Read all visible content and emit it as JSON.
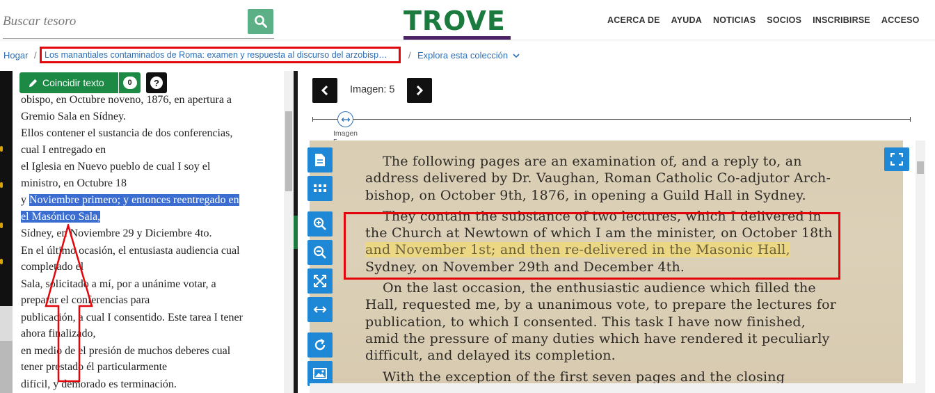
{
  "search": {
    "placeholder": "Buscar tesoro"
  },
  "logo": {
    "text": "TROVE"
  },
  "nav": [
    "ACERCA DE",
    "AYUDA",
    "NOTICIAS",
    "SOCIOS",
    "INSCRIBIRSE",
    "ACCESO"
  ],
  "breadcrumb": {
    "home": "Hogar",
    "separator": "/",
    "current": "Los manantiales contaminados de Roma: examen y respuesta al discurso del arzobisp…",
    "explore": "Explora esta colección"
  },
  "text_panel": {
    "match_button": "Coincidir texto",
    "count": "0",
    "help": "?",
    "lines": [
      [
        "obispo, en Octubre noveno, 1876, en apertura a",
        "Gremio Sala en Sídney."
      ],
      [
        "Ellos contener el sustancia de dos conferencias,",
        "cual I entregado en"
      ],
      [
        "el Iglesia en Nuevo pueblo de cual I soy el",
        "ministro, en Octubre 18"
      ],
      [
        "Sídney, en Noviembre 29 y Diciembre 4to."
      ],
      [
        "En el último ocasión, el entusiasta audiencia cual",
        "completado el"
      ],
      [
        "Sala, solicitado a mí, por a unánime votar, a",
        "preparar el conferencias para"
      ],
      [
        "publicación, a cual I consentido. Este tarea I tener",
        "ahora finalizado,"
      ],
      [
        "en medio de el presión de muchos deberes cual",
        "tener prestado él particularmente"
      ],
      [
        "difícil, y demorado es terminación."
      ]
    ],
    "highlight_prefix": "y",
    "highlight_text_1": "Noviembre primero; y entonces reentregado en",
    "highlight_text_2": "el Masónico Sala,"
  },
  "viewer": {
    "image_label": "Imagen: 5",
    "slider_label_1": "Imagen",
    "slider_label_2": "5",
    "scan_paragraphs": [
      [
        "The following pages are an examination of, and a reply to, an",
        "address delivered by Dr. Vaughan, Roman Catholic Co-adjutor Arch-",
        "bishop, on October 9th, 1876, in opening a Guild Hall in Sydney."
      ],
      [
        "They contain the substance of two lectures, which I delivered in",
        "the Church at Newtown of which I am the minister, on October 18th"
      ],
      [
        "Sydney, on November 29th and December 4th."
      ],
      [
        "On the last occasion, the enthusiastic audience which filled the",
        "Hall, requested me, by a unanimous vote, to prepare the lectures for",
        "publication, to which I consented. This task I have now finished,",
        "amid the pressure of many duties which have rendered it peculiarly",
        "difficult, and delayed its completion."
      ],
      [
        "With the exception of the first seven pages and the closing"
      ]
    ],
    "scan_highlight": "and November 1st; and then re-delivered in the Masonic Hall,"
  },
  "colors": {
    "brand_green": "#1b7a3e",
    "brand_purple": "#4b2266",
    "tool_blue": "#1e88d6",
    "annotation_red": "#e3050a",
    "highlight_blue": "#3b6ccf"
  }
}
